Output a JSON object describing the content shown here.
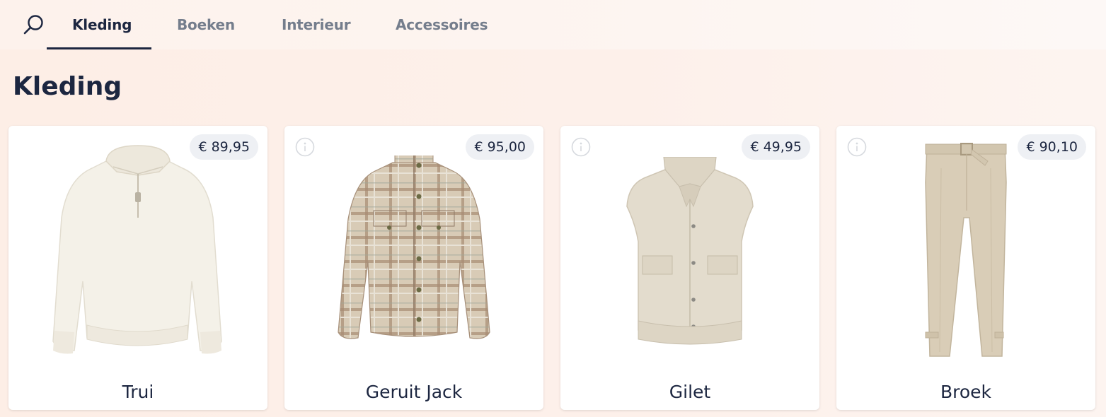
{
  "nav": {
    "search_icon": "search-icon",
    "tabs": [
      {
        "label": "Kleding",
        "active": true
      },
      {
        "label": "Boeken",
        "active": false
      },
      {
        "label": "Interieur",
        "active": false
      },
      {
        "label": "Accessoires",
        "active": false
      }
    ]
  },
  "page": {
    "title": "Kleding"
  },
  "products": [
    {
      "name": "Trui",
      "price": "€ 89,95",
      "info_icon": false,
      "image": "sweater"
    },
    {
      "name": "Geruit Jack",
      "price": "€ 95,00",
      "info_icon": true,
      "image": "plaid-jacket"
    },
    {
      "name": "Gilet",
      "price": "€ 49,95",
      "info_icon": true,
      "image": "gilet"
    },
    {
      "name": "Broek",
      "price": "€ 90,10",
      "info_icon": true,
      "image": "trousers"
    }
  ],
  "colors": {
    "text": "#1c2640",
    "inactive_tab": "#747d8c",
    "price_pill": "#eef0f4",
    "background": "#fdeee6"
  }
}
